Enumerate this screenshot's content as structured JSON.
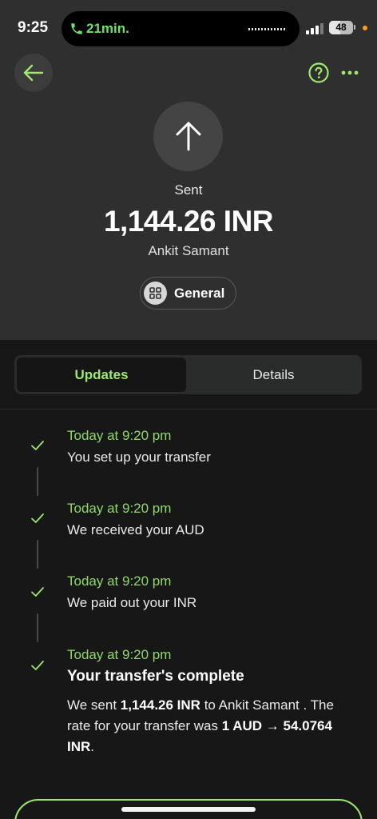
{
  "status_bar": {
    "time": "9:25",
    "call_duration": "21min.",
    "battery": "48",
    "battery_level": 0.48,
    "signal_icon": "cellular-signal-icon",
    "call_icon": "phone-icon"
  },
  "header": {
    "back_icon": "arrow-left-icon",
    "help_icon": "question-circle-icon",
    "more_icon": "more-dots-icon"
  },
  "transfer": {
    "direction_icon": "arrow-up-icon",
    "status": "Sent",
    "amount": "1,144.26 INR",
    "recipient": "Ankit Samant",
    "category_icon": "grid-icon",
    "category": "General"
  },
  "tabs": [
    {
      "label": "Updates",
      "active": true
    },
    {
      "label": "Details",
      "active": false
    }
  ],
  "timeline": [
    {
      "time": "Today at 9:20 pm",
      "text": "You set up your transfer"
    },
    {
      "time": "Today at 9:20 pm",
      "text": "We received your AUD"
    },
    {
      "time": "Today at 9:20 pm",
      "text": "We paid out your INR"
    },
    {
      "time": "Today at 9:20 pm",
      "text": "Your transfer's complete"
    }
  ],
  "completion": {
    "p1": "We sent ",
    "amount": "1,144.26 INR",
    "p2": " to Ankit Samant . The rate for your transfer was ",
    "rate": "1 AUD → 54.0764 INR",
    "p3": "."
  },
  "colors": {
    "accent": "#9fe870",
    "timeline_time": "#8fd86a",
    "call_green": "#6ee36b",
    "background": "#161716",
    "header_bg": "#2e2f2e"
  }
}
